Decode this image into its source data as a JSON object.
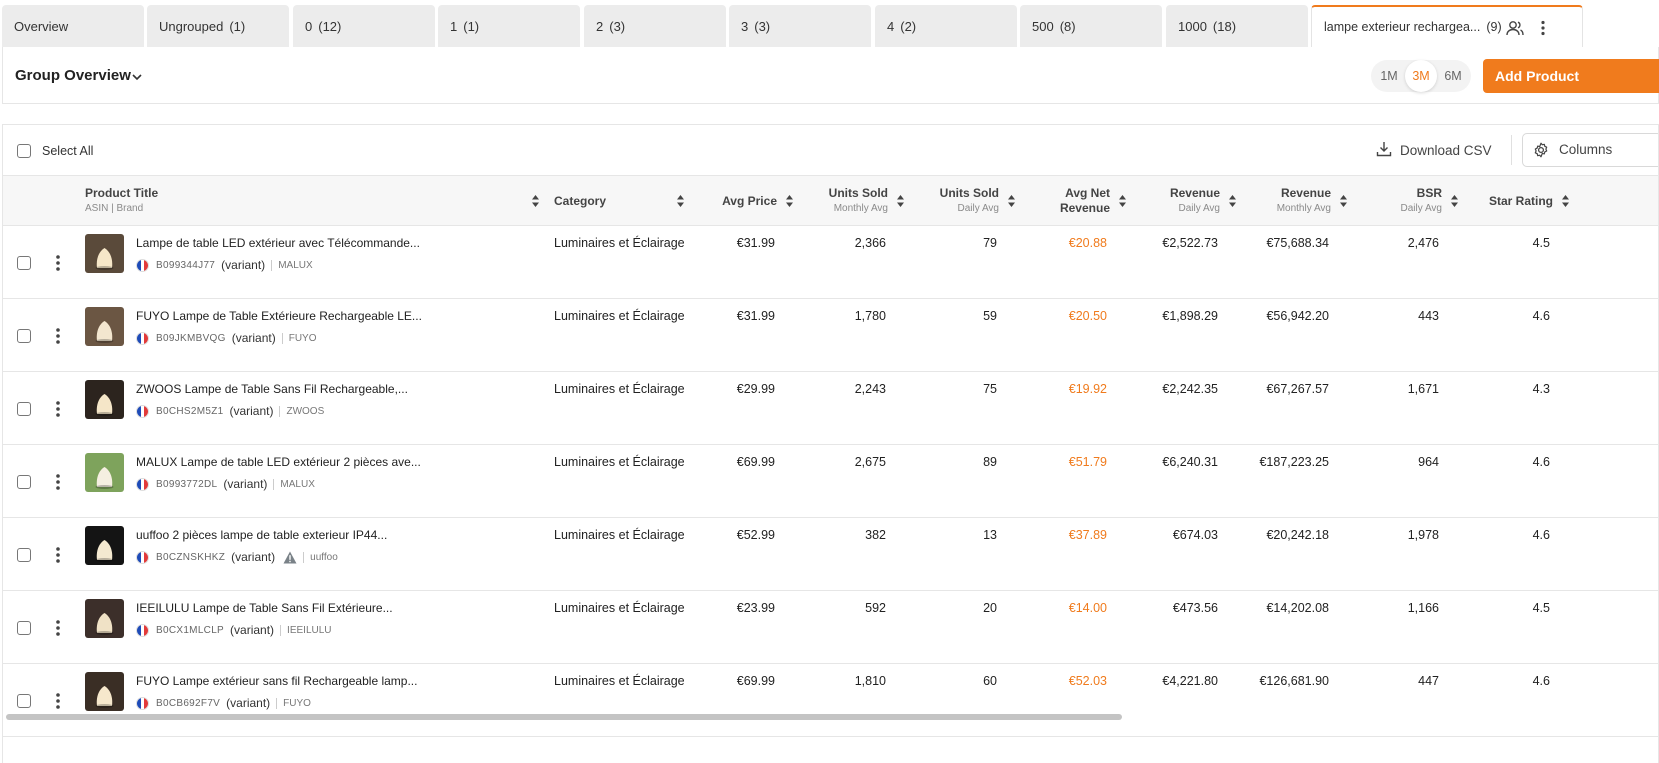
{
  "tabs": [
    {
      "label": "Overview",
      "count": ""
    },
    {
      "label": "Ungrouped",
      "count": "(1)"
    },
    {
      "label": "0",
      "count": "(12)"
    },
    {
      "label": "1",
      "count": "(1)"
    },
    {
      "label": "2",
      "count": "(3)"
    },
    {
      "label": "3",
      "count": "(3)"
    },
    {
      "label": "4",
      "count": "(2)"
    },
    {
      "label": "500",
      "count": "(8)"
    },
    {
      "label": "1000",
      "count": "(18)"
    },
    {
      "label": "lampe exterieur rechargea...",
      "count": "(9)",
      "active": true,
      "icons": [
        "users-icon",
        "more-vertical-icon"
      ]
    }
  ],
  "group": {
    "title": "Group Overview",
    "periods": [
      "1M",
      "3M",
      "6M"
    ],
    "selected_period": "3M",
    "add_button": "Add Product"
  },
  "toolbar": {
    "select_all": "Select All",
    "download": "Download CSV",
    "columns": "Columns"
  },
  "columns": {
    "title": {
      "main": "Product Title",
      "sub": "ASIN | Brand"
    },
    "category": {
      "main": "Category"
    },
    "avg_price": {
      "main": "Avg Price"
    },
    "units_monthly": {
      "main": "Units Sold",
      "sub": "Monthly Avg"
    },
    "units_daily": {
      "main": "Units Sold",
      "sub": "Daily Avg"
    },
    "net_revenue": {
      "main": "Avg Net",
      "main2": "Revenue"
    },
    "revenue_daily": {
      "main": "Revenue",
      "sub": "Daily Avg"
    },
    "revenue_monthly": {
      "main": "Revenue",
      "sub": "Monthly Avg"
    },
    "bsr": {
      "main": "BSR",
      "sub": "Daily Avg"
    },
    "rating": {
      "main": "Star Rating"
    }
  },
  "products": [
    {
      "title": "Lampe de table LED extérieur avec Télécommande...",
      "asin": "B099344J77",
      "variant": "(variant)",
      "brand": "MALUX",
      "warning": false,
      "category": "Luminaires et Éclairage",
      "avg_price": "€31.99",
      "units_monthly": "2,366",
      "units_daily": "79",
      "net_revenue": "€20.88",
      "revenue_daily": "€2,522.73",
      "revenue_monthly": "€75,688.34",
      "bsr": "2,476",
      "rating": "4.5"
    },
    {
      "title": "FUYO Lampe de Table Extérieure Rechargeable LE...",
      "asin": "B09JKMBVQG",
      "variant": "(variant)",
      "brand": "FUYO",
      "warning": false,
      "category": "Luminaires et Éclairage",
      "avg_price": "€31.99",
      "units_monthly": "1,780",
      "units_daily": "59",
      "net_revenue": "€20.50",
      "revenue_daily": "€1,898.29",
      "revenue_monthly": "€56,942.20",
      "bsr": "443",
      "rating": "4.6"
    },
    {
      "title": "ZWOOS Lampe de Table Sans Fil Rechargeable,...",
      "asin": "B0CHS2M5Z1",
      "variant": "(variant)",
      "brand": "ZWOOS",
      "warning": false,
      "category": "Luminaires et Éclairage",
      "avg_price": "€29.99",
      "units_monthly": "2,243",
      "units_daily": "75",
      "net_revenue": "€19.92",
      "revenue_daily": "€2,242.35",
      "revenue_monthly": "€67,267.57",
      "bsr": "1,671",
      "rating": "4.3"
    },
    {
      "title": "MALUX Lampe de table LED extérieur 2 pièces ave...",
      "asin": "B0993772DL",
      "variant": "(variant)",
      "brand": "MALUX",
      "warning": false,
      "category": "Luminaires et Éclairage",
      "avg_price": "€69.99",
      "units_monthly": "2,675",
      "units_daily": "89",
      "net_revenue": "€51.79",
      "revenue_daily": "€6,240.31",
      "revenue_monthly": "€187,223.25",
      "bsr": "964",
      "rating": "4.6"
    },
    {
      "title": "uuffoo 2 pièces lampe de table exterieur IP44...",
      "asin": "B0CZNSKHKZ",
      "variant": "(variant)",
      "brand": "uuffoo",
      "warning": true,
      "category": "Luminaires et Éclairage",
      "avg_price": "€52.99",
      "units_monthly": "382",
      "units_daily": "13",
      "net_revenue": "€37.89",
      "revenue_daily": "€674.03",
      "revenue_monthly": "€20,242.18",
      "bsr": "1,978",
      "rating": "4.6"
    },
    {
      "title": "IEEILULU Lampe de Table Sans Fil Extérieure...",
      "asin": "B0CX1MLCLP",
      "variant": "(variant)",
      "brand": "IEEILULU",
      "warning": false,
      "category": "Luminaires et Éclairage",
      "avg_price": "€23.99",
      "units_monthly": "592",
      "units_daily": "20",
      "net_revenue": "€14.00",
      "revenue_daily": "€473.56",
      "revenue_monthly": "€14,202.08",
      "bsr": "1,166",
      "rating": "4.5"
    },
    {
      "title": "FUYO Lampe extérieur sans fil Rechargeable lamp...",
      "asin": "B0CB692F7V",
      "variant": "(variant)",
      "brand": "FUYO",
      "warning": false,
      "category": "Luminaires et Éclairage",
      "avg_price": "€69.99",
      "units_monthly": "1,810",
      "units_daily": "60",
      "net_revenue": "€52.03",
      "revenue_daily": "€4,221.80",
      "revenue_monthly": "€126,681.90",
      "bsr": "447",
      "rating": "4.6"
    }
  ],
  "colors": {
    "accent": "#f07b1d",
    "flag_blue": "#1e4bb8",
    "flag_white": "#ffffff",
    "flag_red": "#e23a3a"
  }
}
